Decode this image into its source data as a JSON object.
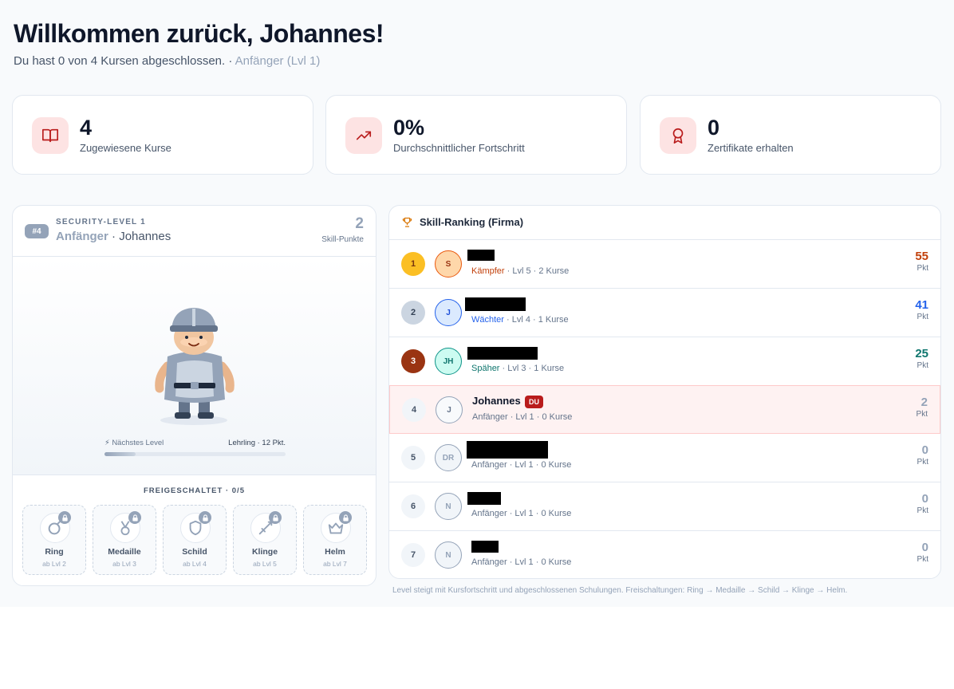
{
  "header": {
    "title": "Willkommen zurück, Johannes!",
    "subtitle": "Du hast 0 von 4 Kursen abgeschlossen. · ",
    "level": "Anfänger (Lvl 1)"
  },
  "stats": [
    {
      "value": "4",
      "label": "Zugewiesene Kurse",
      "icon": "book-icon"
    },
    {
      "value": "0%",
      "label": "Durchschnittlicher Fortschritt",
      "icon": "trending-up-icon"
    },
    {
      "value": "0",
      "label": "Zertifikate erhalten",
      "icon": "award-icon"
    }
  ],
  "profile": {
    "rank": "#4",
    "security_level": "SECURITY-LEVEL 1",
    "rank_name": "Anfänger",
    "separator": " · ",
    "name": "Johannes",
    "points": "2",
    "points_label": "Skill-Punkte",
    "next_level_label": "Nächstes Level",
    "next_level_value": "Lehrling · 12 Pkt.",
    "progress": 0.17,
    "unlocked_label": "FREIGESCHALTET · 0/5",
    "items": [
      {
        "name": "Ring",
        "req": "ab Lvl 2",
        "icon": "ring-icon"
      },
      {
        "name": "Medaille",
        "req": "ab Lvl 3",
        "icon": "medal-icon"
      },
      {
        "name": "Schild",
        "req": "ab Lvl 4",
        "icon": "shield-icon"
      },
      {
        "name": "Klinge",
        "req": "ab Lvl 5",
        "icon": "sword-icon"
      },
      {
        "name": "Helm",
        "req": "ab Lvl 7",
        "icon": "crown-icon"
      }
    ]
  },
  "ranking": {
    "title": "Skill-Ranking (Firma)",
    "pts_label": "Pkt",
    "rows": [
      {
        "pos": "1",
        "initials": "S",
        "name": "",
        "rank": "Kämpfer",
        "meta": " · Lvl 5 · 2 Kurse",
        "points": "55",
        "rank_color": "#c2410c"
      },
      {
        "pos": "2",
        "initials": "J",
        "name": "",
        "rank": "Wächter",
        "meta": " · Lvl 4 · 1 Kurse",
        "points": "41",
        "rank_color": "#2563eb"
      },
      {
        "pos": "3",
        "initials": "JH",
        "name": "",
        "rank": "Späher",
        "meta": " · Lvl 3 · 1 Kurse",
        "points": "25",
        "rank_color": "#0f766e"
      },
      {
        "pos": "4",
        "initials": "J",
        "name": "Johannes",
        "badge": "DU",
        "rank": "Anfänger",
        "meta": " · Lvl 1 · 0 Kurse",
        "points": "2",
        "rank_color": "#64748b"
      },
      {
        "pos": "5",
        "initials": "DR",
        "name": "",
        "rank": "Anfänger",
        "meta": " · Lvl 1 · 0 Kurse",
        "points": "0",
        "rank_color": "#64748b"
      },
      {
        "pos": "6",
        "initials": "N",
        "name": "",
        "rank": "Anfänger",
        "meta": " · Lvl 1 · 0 Kurse",
        "points": "0",
        "rank_color": "#64748b"
      },
      {
        "pos": "7",
        "initials": "N",
        "name": "",
        "rank": "Anfänger",
        "meta": " · Lvl 1 · 0 Kurse",
        "points": "0",
        "rank_color": "#64748b"
      }
    ]
  },
  "footnote": "Level steigt mit Kursfortschritt und abgeschlossenen Schulungen. Freischaltungen: Ring → Medaille → Schild → Klinge → Helm."
}
